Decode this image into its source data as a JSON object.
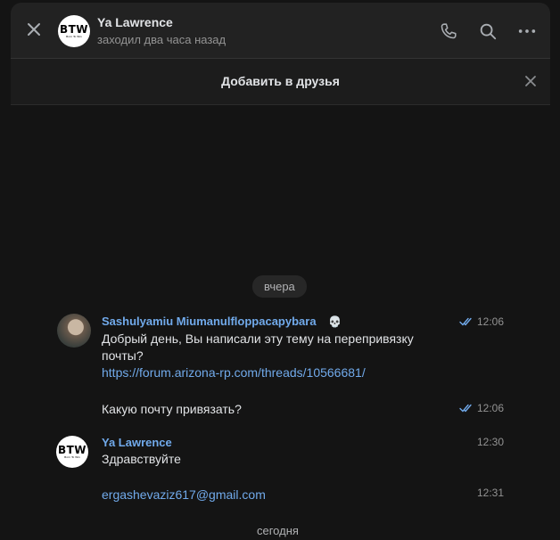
{
  "header": {
    "contact_name": "Ya Lawrence",
    "status": "заходил два часа назад",
    "avatar_text": "BTW",
    "avatar_subtext": "Born To Win",
    "icons": [
      "close-icon",
      "phone-icon",
      "search-icon",
      "more-icon"
    ]
  },
  "friend_bar": {
    "label": "Добавить в друзья"
  },
  "dates": {
    "yesterday": "вчера",
    "today": "сегодня"
  },
  "messages": [
    {
      "sender": "Sashulyamiu Miumanulfloppacapybara",
      "sender_emoji": "💀",
      "text_line1": "Добрый день, Вы написали эту тему на перепривязку",
      "text_line2": "почты?",
      "link": "https://forum.arizona-rp.com/threads/10566681/",
      "time": "12:06"
    },
    {
      "text": "Какую почту привязать?",
      "time": "12:06"
    },
    {
      "sender": "Ya Lawrence",
      "text": "Здравствуйте",
      "time": "12:30"
    },
    {
      "link": "ergashevaziz617@gmail.com",
      "time": "12:31"
    }
  ],
  "colors": {
    "accent": "#71aaeb",
    "background": "#141414",
    "header": "#222222"
  }
}
